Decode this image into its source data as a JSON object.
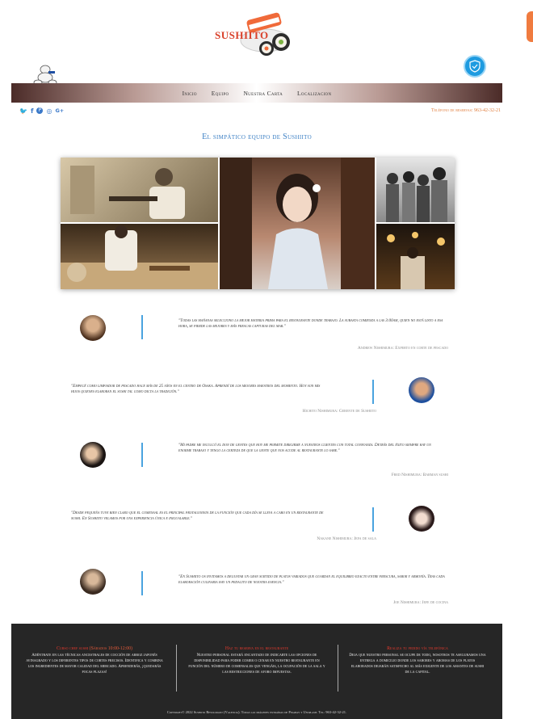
{
  "header": {
    "logo_text": "SUSHIITO"
  },
  "nav": {
    "items": [
      "Inicio",
      "Equipo",
      "Nuestra Carta",
      "Localizacion"
    ]
  },
  "social": {
    "icons": [
      "twitter-icon",
      "facebook-icon",
      "pinterest-icon",
      "instagram-icon",
      "google-plus-icon"
    ],
    "glyphs": [
      "🐦",
      "f",
      "P",
      "◎",
      "G+"
    ]
  },
  "phone_text": "Teléfono de reservas: 963-42-32-21",
  "section_title": "El simpático equipo de Sushiito",
  "testimonials": [
    {
      "quote": "\"Todas las mañanas selecciono la mejor materia prima para el restaurante donde trabajo. La subasta comienza a las 3:00am, quien no está listo a esa hora, se pierde las mejores y más frescas capturas del mar.\"",
      "author": "Andrew Nishimura: Experto en corte de pescado"
    },
    {
      "quote": "\"Empecé como limpiador de pescado hace más de 25 años en el centro de Osaka. Aprendí de los mejores maestros del momento. Hoy son mis hijos quienes elaboran el sushi tal como dicta la tradición.\"",
      "author": "Hichito Nishimura: Gerente de Sushiito"
    },
    {
      "quote": "\"Mi padre me inculcó el don de gentes que hoy me permite dirigirme a nuestros clientes con total confianza. Detrás del éxito siempre hay un enorme trabajo y tengo la certeza de que la gente que nos acude al restaurante lo sabe.\"",
      "author": "Fred Nishimura: Barman sushi"
    },
    {
      "quote": "\"Desde pequeña tuve bien claro que el comensal es el principal protagonista de la función que cada día se lleva a cabo en un restaurante de sushi. En Sushiito velamos por una experiencia única e inigualable.\"",
      "author": "Nakane Nishimura: Jefa de sala"
    },
    {
      "quote": "\"En Sushiito os invitamos a degustar un gran surtido de platos variados que guardan el equilibrio exacto entre frescura, sabor y armonía. Tras cada elaboración culinaria hay un pedacito de nuestra esencia.\"",
      "author": "Joe Nishimura: Jefe de cocina"
    }
  ],
  "footer": {
    "columns": [
      {
        "heading": "Curso chef sushi",
        "heading_extra": "(Sábados 10:00-12:00)",
        "body": "Adéntrate en las técnicas ancestrales de cocción de arroz japonés avinagrado y los diferentes tipos de cortes precisos. Identifica y combina los ingredientes de mayor calidad del mercado. Aprenderás, ¡quedarás pocas plazas!"
      },
      {
        "heading": "Haz tu reserva en el restaurante",
        "body": "Nuestro personal estará encantado de indicarte las opciones de disponibilidad para poder comer o cenar en nuestro restaurante en función del número de comensales que vengáis, la ocupación de la sala y las restricciones de aforo impuestas."
      },
      {
        "heading": "Realiza tu pedido vía telefónica",
        "body": "Deja que nuestro personal se ocupe de todo, nosotros te aseguramos una entrega a domicilio donde los sabores y aromas de los platos elaborados dejarán satisfecho al más exigente de los amantes de sushi de la capital."
      }
    ],
    "copyright": "Copyright© 2022 Sushiito Restaurant (Valencia). Todas las imágenes extraídas de Pixabay y Unsplash. Tel: 963-42-32-21."
  },
  "colors": {
    "accent_blue": "#3b7fc4",
    "accent_orange": "#e07b3a",
    "footer_red": "#e63a2e",
    "footer_bg": "#262626"
  }
}
